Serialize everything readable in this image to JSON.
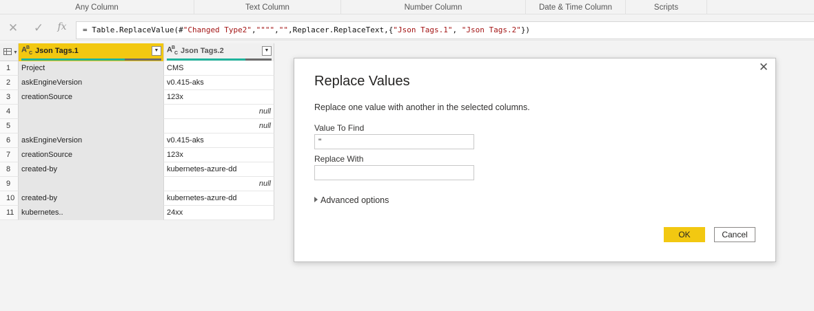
{
  "ribbon": {
    "groups": [
      {
        "label": "Any Column"
      },
      {
        "label": "Text Column"
      },
      {
        "label": "Number Column"
      },
      {
        "label": "Date & Time Column"
      },
      {
        "label": "Scripts"
      }
    ]
  },
  "formula_bar": {
    "cancel_icon": "close-icon",
    "commit_icon": "checkmark-icon",
    "fx_label": "fx",
    "prefix": "= Table.ReplaceValue(#",
    "step": "\"Changed Type2\"",
    "sep1": ",",
    "find": "\"\"\"\"",
    "sep2": ",",
    "replace": "\"\"",
    "mid": ",Replacer.ReplaceText,{",
    "col1": "\"Json Tags.1\"",
    "sep3": ", ",
    "col2": "\"Json Tags.2\"",
    "suffix": "})"
  },
  "grid": {
    "columns": [
      {
        "type_label": "ABC",
        "name": "Json Tags.1",
        "selected": true
      },
      {
        "type_label": "ABC",
        "name": "Json Tags.2",
        "selected": false
      }
    ],
    "rows": [
      {
        "num": "1",
        "c1": "Project",
        "c2": "CMS"
      },
      {
        "num": "2",
        "c1": "askEngineVersion",
        "c2": "v0.415-aks"
      },
      {
        "num": "3",
        "c1": "creationSource",
        "c2": "123x"
      },
      {
        "num": "4",
        "c1": "",
        "c2": "null"
      },
      {
        "num": "5",
        "c1": "",
        "c2": "null"
      },
      {
        "num": "6",
        "c1": "askEngineVersion",
        "c2": "v0.415-aks"
      },
      {
        "num": "7",
        "c1": "creationSource",
        "c2": "123x"
      },
      {
        "num": "8",
        "c1": "created-by",
        "c2": "kubernetes-azure-dd"
      },
      {
        "num": "9",
        "c1": "",
        "c2": "null"
      },
      {
        "num": "10",
        "c1": "created-by",
        "c2": "kubernetes-azure-dd"
      },
      {
        "num": "11",
        "c1": "kubernetes..",
        "c2": "24xx"
      }
    ]
  },
  "dialog": {
    "title": "Replace Values",
    "description": "Replace one value with another in the selected columns.",
    "find_label": "Value To Find",
    "find_value": "\"",
    "replace_label": "Replace With",
    "replace_value": "",
    "advanced_label": "Advanced options",
    "ok_label": "OK",
    "cancel_label": "Cancel",
    "close_icon": "close-icon"
  },
  "colors": {
    "accent": "#f2c811",
    "quality_valid": "#1fb39c",
    "quality_empty": "#6b6b6b"
  }
}
